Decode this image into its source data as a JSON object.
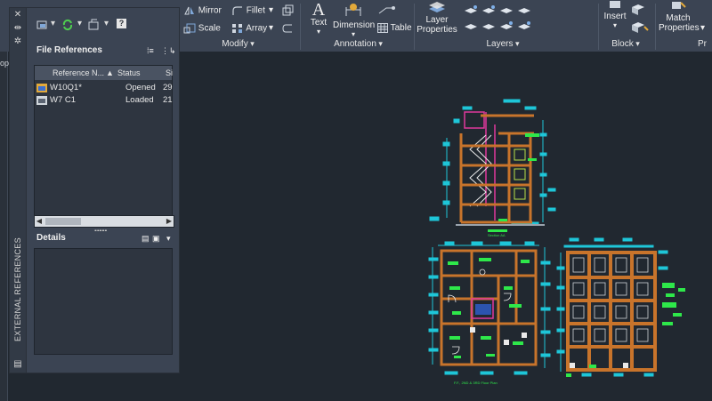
{
  "ribbon": {
    "modify": {
      "title": "Modify",
      "mirror": "Mirror",
      "fillet": "Fillet",
      "scale": "Scale",
      "array": "Array"
    },
    "annotation": {
      "title": "Annotation",
      "text": "Text",
      "dimension": "Dimension",
      "table": "Table"
    },
    "layers": {
      "title": "Layers",
      "layer_properties_1": "Layer",
      "layer_properties_2": "Properties"
    },
    "block": {
      "title": "Block",
      "insert": "Insert"
    },
    "properties": {
      "title": "Pr",
      "match_1": "Match",
      "match_2": "Properties"
    }
  },
  "left_strip_text": "op]",
  "palette": {
    "vertical_title": "EXTERNAL REFERENCES",
    "file_references": {
      "title": "File References",
      "columns": [
        "Reference N...",
        "Status",
        "Si"
      ],
      "rows": [
        {
          "name": "W10Q1*",
          "status": "Opened",
          "size": "29"
        },
        {
          "name": "W7 C1",
          "status": "Loaded",
          "size": "21"
        }
      ]
    },
    "details": {
      "title": "Details"
    }
  },
  "drawing_labels": {
    "section": "Section AA",
    "plan": "F.F., 2ND & 3RD Floor Plan"
  },
  "colors": {
    "wall": "#c8742b",
    "dim": "#1ec6d8",
    "text": "#2ee84a",
    "stair": "#e0389c",
    "ribbon": "#3b4453",
    "canvas": "#212830"
  }
}
